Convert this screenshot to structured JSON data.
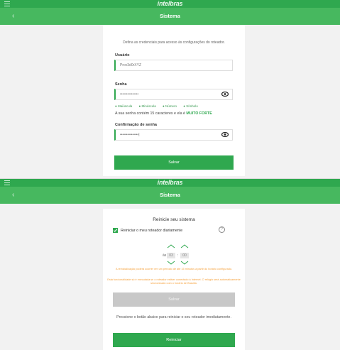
{
  "brand": "intelbras",
  "screen1": {
    "title": "Sistema",
    "intro": "Defina as credenciais para acesso às configurações do roteador.",
    "username_label": "Usuário",
    "username_value": "Prov3d0rXYZ",
    "password_label": "Senha",
    "password_value": "•••••••••••••••",
    "rules": [
      "Maiúscula",
      "Minúscula",
      "Número",
      "Símbolo"
    ],
    "strength_prefix": "A sua senha contém 15 caracteres e ela é",
    "strength_value": "MUITO FORTE",
    "confirm_label": "Confirmação de senha",
    "confirm_value": "•••••••••••••••|",
    "save_button": "Salvar"
  },
  "screen2": {
    "title": "Sistema",
    "heading": "Reinicie seu sistema",
    "daily_restart_label": "Reiniciar o meu roteador diariamente",
    "help_symbol": "?",
    "time_prefix": "às",
    "hour": "03",
    "separator": ":",
    "minute": "00",
    "warning1": "A reinicialização poderá ocorrer em um período de até 15 minutos a partir do horário configurado.",
    "warning2": "Esta funcionalidade só é executada se o roteador estiver conectado à Internet. O relógio será automaticamente sincronizado com o horário de Brasília.",
    "save_button": "Salvar",
    "restart_info": "Pressione o botão abaixo para reiniciar o seu roteador imediatamente.",
    "restart_button": "Reiniciar"
  },
  "colors": {
    "primary": "#2fa84f",
    "warning": "#f5a03a",
    "disabled": "#c8c8c8"
  }
}
